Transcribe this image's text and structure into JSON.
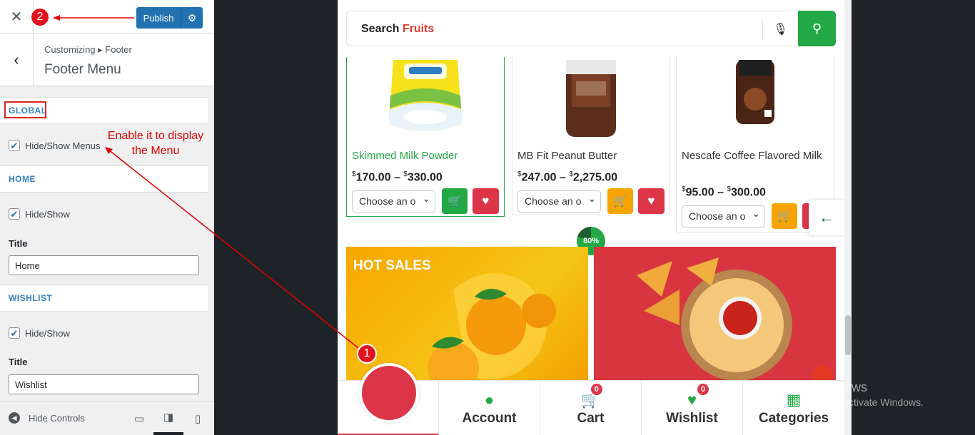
{
  "sidebar": {
    "close_glyph": "✕",
    "publish_label": "Publish",
    "breadcrumb": "Customizing ▸ Footer",
    "panel_title": "Footer Menu",
    "sections": {
      "global": {
        "title": "GLOBAL",
        "checkbox_label": "Hide/Show Menus"
      },
      "home": {
        "title": "HOME",
        "checkbox_label": "Hide/Show",
        "title_label": "Title",
        "title_value": "Home"
      },
      "wishlist": {
        "title": "WISHLIST",
        "checkbox_label": "Hide/Show",
        "title_label": "Title",
        "title_value": "Wishlist"
      }
    },
    "footer": {
      "hide_controls_label": "Hide Controls"
    }
  },
  "annotations": {
    "step1": "1",
    "step2": "2",
    "note_line1": "Enable it to display",
    "note_line2": "the Menu",
    "color": "#e00000"
  },
  "preview": {
    "search": {
      "prefix": "Search",
      "accent": "Fruits"
    },
    "products": [
      {
        "name": "Skimmed Milk Powder",
        "currency": "$",
        "price_low": "170.00",
        "price_high": "330.00",
        "option_placeholder": "Choose an o"
      },
      {
        "name": "MB Fit Peanut Butter",
        "currency": "$",
        "price_low": "247.00",
        "price_high": "2,275.00",
        "option_placeholder": "Choose an o"
      },
      {
        "name": "Nescafe Coffee Flavored Milk",
        "currency": "$",
        "price_low": "95.00",
        "price_high": "300.00",
        "option_placeholder": "Choose an o"
      }
    ],
    "price_sep": "–",
    "progress_label": "80%",
    "progress_value": 0.8,
    "banner_hot": "HOT SALES",
    "nav": {
      "account": "Account",
      "cart": "Cart",
      "cart_count": "0",
      "wishlist": "Wishlist",
      "wishlist_count": "0",
      "categories": "Categories"
    },
    "colors": {
      "green": "#22a845",
      "red": "#dd3548",
      "orange": "#f7a400",
      "accent": "#e03c31"
    }
  },
  "watermark": {
    "line1": "Activate Windows",
    "line2": "Go to Settings to activate Windows."
  }
}
